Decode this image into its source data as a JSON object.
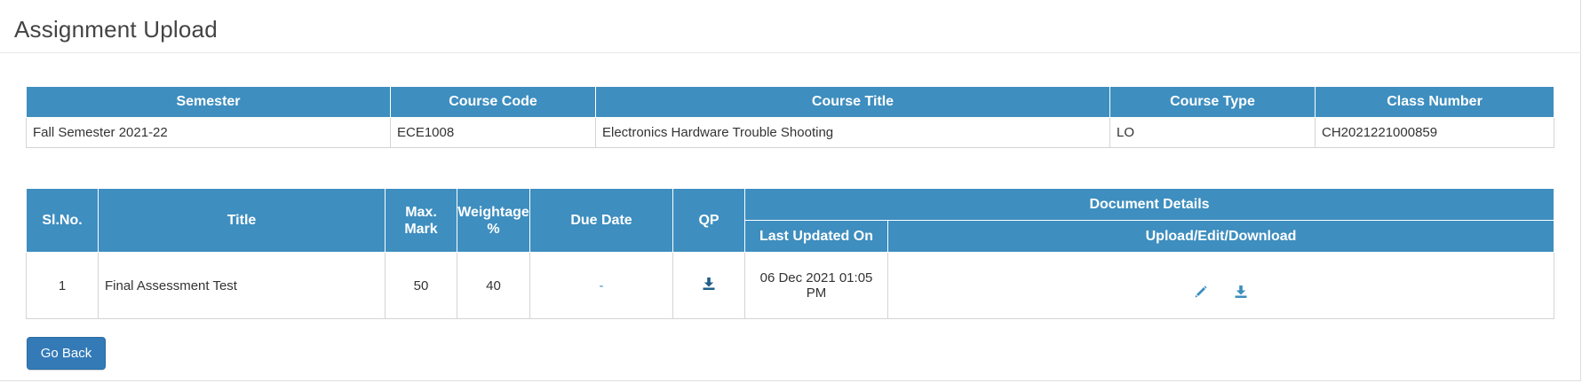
{
  "page": {
    "title": "Assignment Upload"
  },
  "course_table": {
    "headers": [
      "Semester",
      "Course Code",
      "Course Title",
      "Course Type",
      "Class Number"
    ],
    "row": [
      "Fall Semester 2021-22",
      "ECE1008",
      "Electronics Hardware Trouble Shooting",
      "LO",
      "CH2021221000859"
    ]
  },
  "assignment_table": {
    "headers": {
      "slno": "Sl.No.",
      "title": "Title",
      "max_mark_1": "Max.",
      "max_mark_2": "Mark",
      "weightage_1": "Weightage",
      "weightage_2": "%",
      "due_date": "Due Date",
      "qp": "QP",
      "document_details": "Document Details",
      "last_updated": "Last Updated On",
      "upload": "Upload/Edit/Download"
    },
    "rows": [
      {
        "slno": "1",
        "title": "Final Assessment Test",
        "max_mark": "50",
        "weightage": "40",
        "due_date": "-",
        "qp_icon": "download-icon",
        "last_updated": "06 Dec 2021 01:05 PM",
        "action_icons": [
          "edit-pencil-icon",
          "download-icon"
        ]
      }
    ]
  },
  "actions": {
    "go_back": "Go Back"
  },
  "colors": {
    "header_bg": "#3e8ebf",
    "button_bg": "#337ab7",
    "icon": "#1f5f8b"
  }
}
